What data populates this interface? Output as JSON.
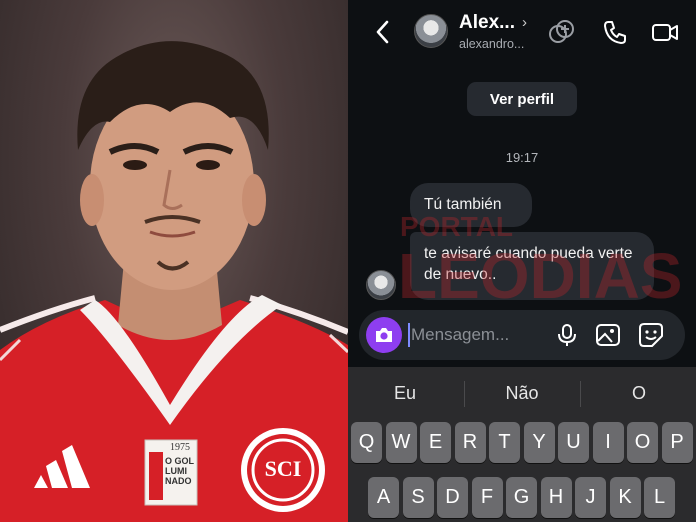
{
  "photo": {
    "jersey_badge_year": "1975",
    "jersey_badge_text": "O GOL LUMI NADO",
    "crest_letters": "SCI"
  },
  "header": {
    "contact_name": "Alex...",
    "contact_handle": "alexandro...",
    "icons": [
      "back-icon",
      "effects-icon",
      "call-icon",
      "video-icon"
    ]
  },
  "chat": {
    "view_profile_label": "Ver perfil",
    "timestamp": "19:17",
    "messages": [
      "Tú también",
      "te avisaré cuando pueda verte de nuevo.."
    ]
  },
  "watermark": {
    "line1": "PORTAL",
    "line2": "LEODIAS"
  },
  "composer": {
    "placeholder": "Mensagem...",
    "icons": [
      "camera-icon",
      "mic-icon",
      "gallery-icon",
      "sticker-icon"
    ]
  },
  "keyboard": {
    "suggestions": [
      "Eu",
      "Não",
      "O"
    ],
    "row1": [
      "Q",
      "W",
      "E",
      "R",
      "T",
      "Y",
      "U",
      "I",
      "O",
      "P"
    ],
    "row2": [
      "A",
      "S",
      "D",
      "F",
      "G",
      "H",
      "J",
      "K",
      "L"
    ]
  },
  "colors": {
    "accent_purple": "#8e3ef0",
    "bubble_bg": "#262a30",
    "chat_bg": "#0d1013",
    "jersey_red": "#d62027",
    "watermark_red": "#c0242a"
  }
}
